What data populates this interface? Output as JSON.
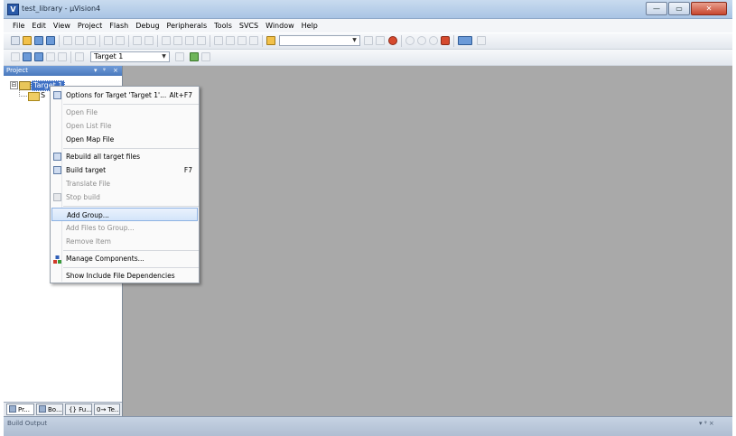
{
  "window": {
    "title": "test_library - µVision4",
    "min_glyph": "—",
    "max_glyph": "▭",
    "close_glyph": "✕"
  },
  "menubar": [
    "File",
    "Edit",
    "View",
    "Project",
    "Flash",
    "Debug",
    "Peripherals",
    "Tools",
    "SVCS",
    "Window",
    "Help"
  ],
  "toolbar2": {
    "target_combo": "Target 1"
  },
  "project_panel": {
    "title": "Project",
    "pin_glyph": "▾",
    "dock_glyph": "ᵠ",
    "close_glyph": "×",
    "tree": {
      "expander": "⊟",
      "target": "Target 1",
      "group": "S"
    },
    "tabs": [
      "Pr...",
      "Bo...",
      "{} Fu...",
      "0→ Te..."
    ]
  },
  "context_menu": {
    "items": [
      {
        "label": "Options for Target 'Target 1'...",
        "shortcut": "Alt+F7",
        "disabled": false
      },
      {
        "label": "Open File",
        "disabled": true
      },
      {
        "label": "Open List File",
        "disabled": true
      },
      {
        "label": "Open Map File",
        "disabled": false
      },
      {
        "label": "Rebuild all target files",
        "disabled": false
      },
      {
        "label": "Build target",
        "shortcut": "F7",
        "disabled": false
      },
      {
        "label": "Translate File",
        "disabled": true
      },
      {
        "label": "Stop build",
        "disabled": true
      },
      {
        "label": "Add Group...",
        "disabled": false,
        "highlighted": true
      },
      {
        "label": "Add Files to Group...",
        "disabled": true
      },
      {
        "label": "Remove Item",
        "disabled": true
      },
      {
        "label": "Manage Components...",
        "disabled": false
      },
      {
        "label": "Show Include File Dependencies",
        "disabled": false
      }
    ]
  },
  "output": {
    "title": "Build Output",
    "ctrl_glyphs": "▾ ᵠ ×"
  },
  "colors": {
    "workspace": "#a9a9a9",
    "panel_header": "#4a79bd",
    "selection": "#3d6fc4",
    "menu_highlight": "#d3e5fa"
  }
}
